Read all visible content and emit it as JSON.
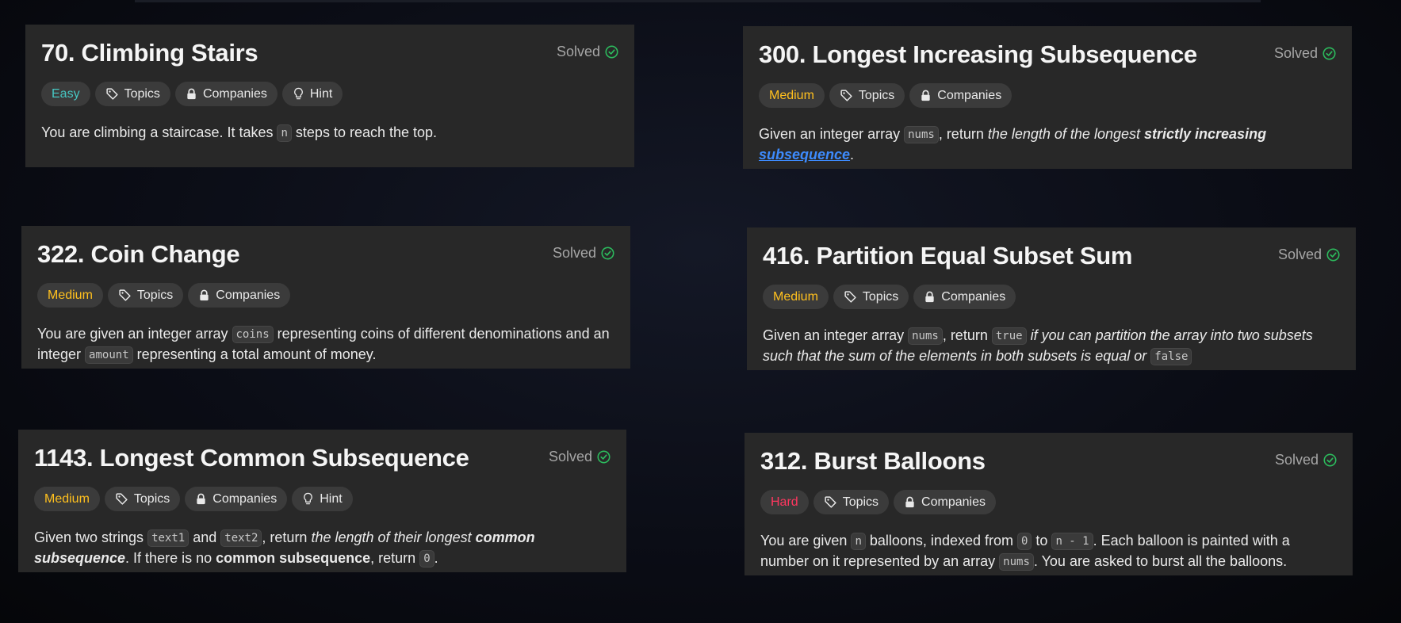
{
  "status_label": "Solved",
  "tags": {
    "topics": "Topics",
    "companies": "Companies",
    "hint": "Hint"
  },
  "colors": {
    "easy": "#46c6c2",
    "medium": "#ffc01e",
    "hard": "#ff375f",
    "solved_check": "#2cbb5d",
    "card_bg": "#282828"
  },
  "cards": [
    {
      "title": "70. Climbing Stairs",
      "difficulty": "Easy",
      "has_hint": true,
      "desc": [
        {
          "t": "You are climbing a staircase. It takes "
        },
        {
          "t": "n",
          "style": "code"
        },
        {
          "t": " steps to reach the top."
        }
      ]
    },
    {
      "title": "300. Longest Increasing Subsequence",
      "difficulty": "Medium",
      "has_hint": false,
      "desc": [
        {
          "t": "Given an integer array "
        },
        {
          "t": "nums",
          "style": "code"
        },
        {
          "t": ", return "
        },
        {
          "t": "the length of the longest ",
          "style": "em"
        },
        {
          "t": "strictly increasing",
          "style": "strong em"
        },
        {
          "t": " ",
          "style": "em"
        },
        {
          "t": "subsequence",
          "style": "link"
        },
        {
          "t": "."
        }
      ]
    },
    {
      "title": "322. Coin Change",
      "difficulty": "Medium",
      "has_hint": false,
      "desc": [
        {
          "t": "You are given an integer array "
        },
        {
          "t": "coins",
          "style": "code"
        },
        {
          "t": " representing coins of different denominations and an integer "
        },
        {
          "t": "amount",
          "style": "code"
        },
        {
          "t": " representing a total amount of money."
        }
      ]
    },
    {
      "title": "416. Partition Equal Subset Sum",
      "difficulty": "Medium",
      "has_hint": false,
      "desc": [
        {
          "t": "Given an integer array "
        },
        {
          "t": "nums",
          "style": "code"
        },
        {
          "t": ", return "
        },
        {
          "t": "true",
          "style": "code"
        },
        {
          "t": " "
        },
        {
          "t": "if you can partition the array into two subsets such that the sum of the elements in both subsets is equal or ",
          "style": "em"
        },
        {
          "t": "false",
          "style": "code"
        }
      ]
    },
    {
      "title": "1143. Longest Common Subsequence",
      "difficulty": "Medium",
      "has_hint": true,
      "desc": [
        {
          "t": "Given two strings "
        },
        {
          "t": "text1",
          "style": "code"
        },
        {
          "t": " and "
        },
        {
          "t": "text2",
          "style": "code"
        },
        {
          "t": ", return "
        },
        {
          "t": "the length of their longest ",
          "style": "em"
        },
        {
          "t": "common subsequence",
          "style": "strong em"
        },
        {
          "t": ". If there is no "
        },
        {
          "t": "common subsequence",
          "style": "strong"
        },
        {
          "t": ", return "
        },
        {
          "t": "0",
          "style": "code"
        },
        {
          "t": "."
        }
      ]
    },
    {
      "title": "312. Burst Balloons",
      "difficulty": "Hard",
      "has_hint": false,
      "desc": [
        {
          "t": "You are given "
        },
        {
          "t": "n",
          "style": "code"
        },
        {
          "t": " balloons, indexed from "
        },
        {
          "t": "0",
          "style": "code"
        },
        {
          "t": " to "
        },
        {
          "t": "n - 1",
          "style": "code"
        },
        {
          "t": ". Each balloon is painted with a number on it represented by an array "
        },
        {
          "t": "nums",
          "style": "code"
        },
        {
          "t": ". You are asked to burst all the balloons."
        }
      ]
    }
  ]
}
